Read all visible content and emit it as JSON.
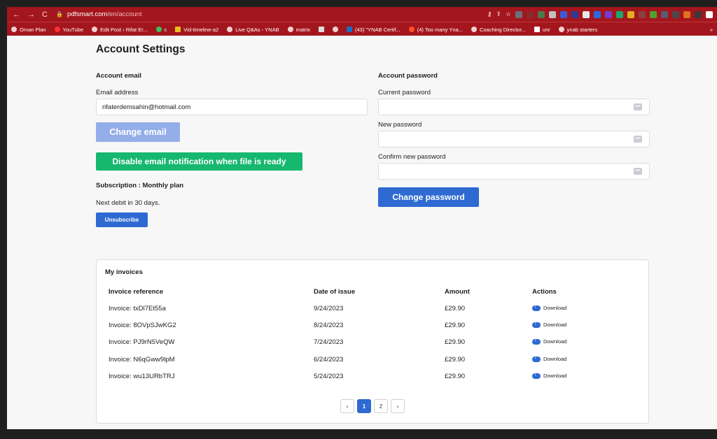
{
  "browser": {
    "host": "pdfsmart.com",
    "path": "/en/account",
    "bookmarks": [
      "Oman Plan",
      "YouTube",
      "Edit Post ‹ Rifat Er...",
      "c",
      "Vid-timeline-a2",
      "Live Q&As - YNAB",
      "matrix",
      "(43) \"YNAB Certif...",
      "(4) Too many Yna...",
      "Coaching Director...",
      "unr",
      "ynab starters"
    ],
    "more": "»"
  },
  "page": {
    "title": "Account Settings",
    "email_section": {
      "heading": "Account email",
      "label": "Email address",
      "value": "rifaterdemsahin@hotmail.com",
      "change_button": "Change email",
      "disable_button": "Disable email notification when file is ready"
    },
    "subscription": {
      "heading": "Subscription : Monthly plan",
      "next_debit": "Next debit in 30 days.",
      "unsubscribe": "Unsubscribe"
    },
    "password_section": {
      "heading": "Account password",
      "current_label": "Current password",
      "new_label": "New password",
      "confirm_label": "Confirm new password",
      "change_button": "Change password"
    },
    "invoices": {
      "title": "My invoices",
      "columns": [
        "Invoice reference",
        "Date of issue",
        "Amount",
        "Actions"
      ],
      "rows": [
        {
          "ref": "Invoice: txDl7Et55a",
          "date": "9/24/2023",
          "amount": "£29.90",
          "action": "Download"
        },
        {
          "ref": "Invoice: 8OVpSJwKG2",
          "date": "8/24/2023",
          "amount": "£29.90",
          "action": "Download"
        },
        {
          "ref": "Invoice: PJ9rN5VeQW",
          "date": "7/24/2023",
          "amount": "£29.90",
          "action": "Download"
        },
        {
          "ref": "Invoice: N6qGww9lpM",
          "date": "6/24/2023",
          "amount": "£29.90",
          "action": "Download"
        },
        {
          "ref": "Invoice: wu13URbTRJ",
          "date": "5/24/2023",
          "amount": "£29.90",
          "action": "Download"
        }
      ],
      "pagination": {
        "prev": "‹",
        "pages": [
          "1",
          "2"
        ],
        "current": "1",
        "next": "›"
      }
    }
  },
  "colors": {
    "chrome": "#a4161d",
    "primary": "#2e6ad1",
    "disabled_primary": "#93aee8",
    "green": "#15b86e"
  }
}
